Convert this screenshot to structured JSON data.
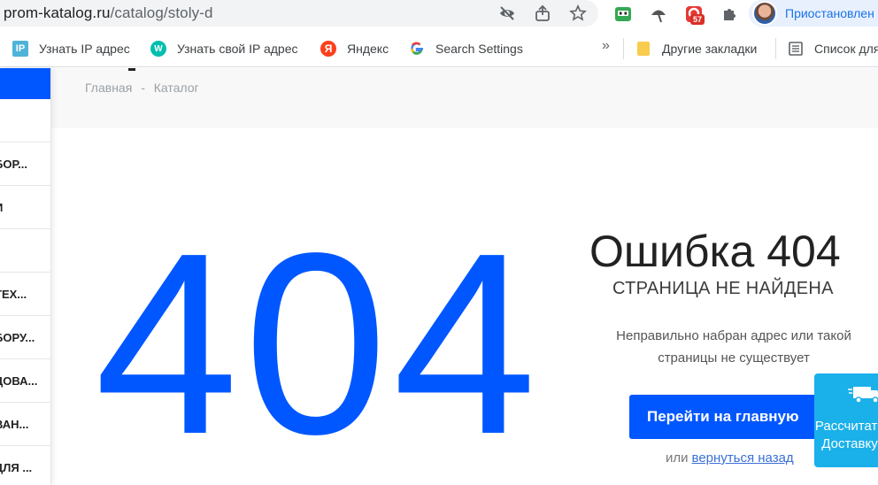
{
  "browser": {
    "url_host": "prom-katalog.ru",
    "url_path": "/catalog/stoly-d",
    "extension_badge": "57",
    "profile_label": "Приостановлен"
  },
  "bookmarks": {
    "items": [
      {
        "label": "Узнать IP адрес",
        "icon_text": "IP"
      },
      {
        "label": "Узнать свой IP адрес",
        "icon_text": "W"
      },
      {
        "label": "Яндекс",
        "icon_text": "Я"
      },
      {
        "label": "Search Settings",
        "icon_text": "G"
      }
    ],
    "more": "»",
    "other_label": "Другие закладки",
    "reading_list_label": "Список для"
  },
  "breadcrumbs": {
    "home": "Главная",
    "separator": "-",
    "catalog": "Каталог"
  },
  "sidebar": {
    "items": [
      "",
      "БОР...",
      "И",
      "",
      "ТЕХ...",
      "БОРУ...",
      "ДОВА...",
      "ВАН...",
      "ДЛЯ ..."
    ]
  },
  "error": {
    "code": "404",
    "title": "Ошибка 404",
    "subtitle": "СТРАНИЦА НЕ НАЙДЕНА",
    "description": "Неправильно набран адрес или такой страницы не существует",
    "home_button": "Перейти на главную",
    "or_text": "или",
    "back_link": "вернуться назад"
  },
  "delivery": {
    "line1": "Рассчитать",
    "line2": "Доставку"
  },
  "colors": {
    "accent": "#0057ff",
    "delivery": "#1ab0ea"
  }
}
